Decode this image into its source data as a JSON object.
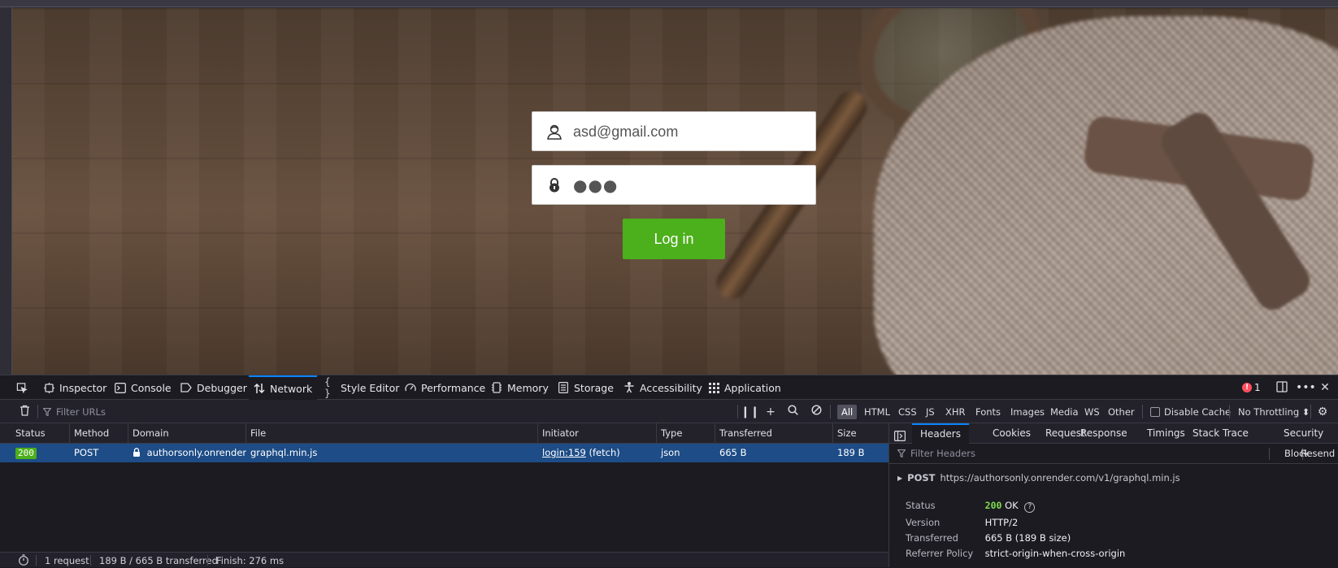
{
  "login": {
    "email_value": "asd@gmail.com",
    "password_dots": "●●●",
    "button_label": "Log in",
    "button_color": "#4caf1c"
  },
  "devtools": {
    "tabs": {
      "inspector": "Inspector",
      "console": "Console",
      "debugger": "Debugger",
      "network": "Network",
      "style_editor": "Style Editor",
      "performance": "Performance",
      "memory": "Memory",
      "storage": "Storage",
      "accessibility": "Accessibility",
      "application": "Application"
    },
    "active_tab": "network",
    "error_count": "1",
    "accent": "#0a84ff"
  },
  "network": {
    "filter_placeholder": "Filter URLs",
    "filter_types": [
      "All",
      "HTML",
      "CSS",
      "JS",
      "XHR",
      "Fonts",
      "Images",
      "Media",
      "WS",
      "Other"
    ],
    "selected_type": "All",
    "disable_cache": "Disable Cache",
    "throttling": "No Throttling ⬍",
    "columns": {
      "status": "Status",
      "method": "Method",
      "domain": "Domain",
      "file": "File",
      "initiator": "Initiator",
      "type": "Type",
      "transferred": "Transferred",
      "size": "Size"
    },
    "request": {
      "status": "200",
      "method": "POST",
      "domain": "authorsonly.onrender…",
      "file": "graphql.min.js",
      "initiator_link": "login:159",
      "initiator_kind": "(fetch)",
      "type": "json",
      "transferred": "665 B",
      "size": "189 B"
    },
    "status_bar": {
      "requests": "1 request",
      "transferred": "189 B / 665 B transferred",
      "finish": "Finish: 276 ms"
    }
  },
  "details": {
    "tabs": {
      "headers": "Headers",
      "cookies": "Cookies",
      "request": "Request",
      "response": "Response",
      "timings": "Timings",
      "stack_trace": "Stack Trace",
      "security": "Security"
    },
    "filter_placeholder": "Filter Headers",
    "block": "Block",
    "resend": "Resend",
    "method": "POST",
    "url": "https://authorsonly.onrender.com/v1/graphql.min.js",
    "rows": {
      "status_key": "Status",
      "status_code": "200",
      "status_text": "OK",
      "version_key": "Version",
      "version_val": "HTTP/2",
      "transferred_key": "Transferred",
      "transferred_val": "665 B (189 B size)",
      "referrer_key": "Referrer Policy",
      "referrer_val": "strict-origin-when-cross-origin"
    }
  }
}
